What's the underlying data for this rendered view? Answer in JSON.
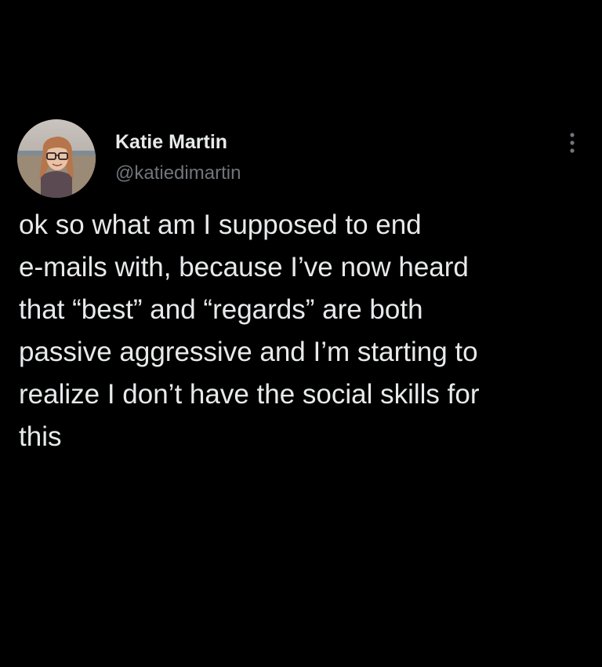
{
  "tweet": {
    "author": {
      "display_name": "Katie Martin",
      "handle": "@katiedimartin",
      "avatar_icon": "avatar"
    },
    "more_icon": "more-options-icon",
    "text": "ok so what am I supposed to end\ne-mails with, because I’ve now heard\nthat “best” and “regards” are both\npassive aggressive and I’m starting to\nrealize I don’t have the social skills for\nthis"
  },
  "colors": {
    "background": "#000000",
    "primary_text": "#e7e9ea",
    "secondary_text": "#71767b"
  }
}
